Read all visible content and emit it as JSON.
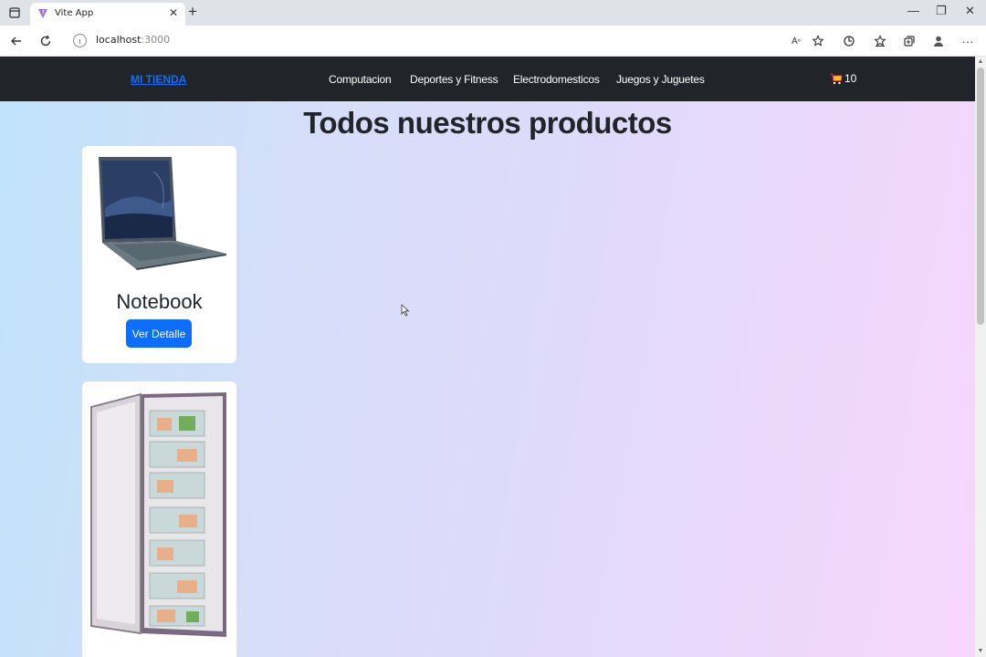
{
  "browser": {
    "tab_title": "Vite App",
    "url_host": "localhost",
    "url_port": ":3000"
  },
  "navbar": {
    "brand": "MI TIENDA",
    "links": [
      "Computacion",
      "Deportes y Fitness",
      "Electrodomesticos",
      "Juegos y Juguetes"
    ],
    "cart_count": "10"
  },
  "main": {
    "title": "Todos nuestros productos",
    "products": [
      {
        "title": "Notebook",
        "button": "Ver Detalle",
        "image": "laptop-image"
      },
      {
        "title": "",
        "button": "",
        "image": "refrigerator-image"
      }
    ]
  },
  "colors": {
    "navbar_bg": "#212529",
    "brand": "#0d6efd",
    "button": "#0d6efd"
  }
}
